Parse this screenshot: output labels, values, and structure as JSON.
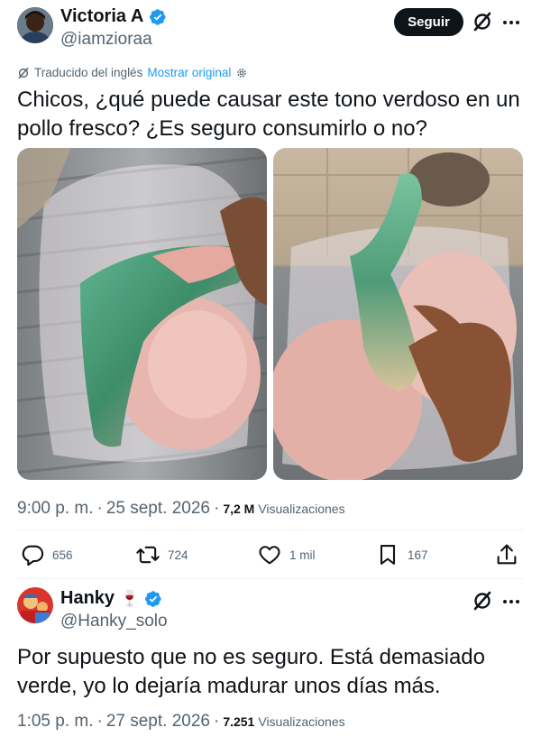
{
  "tweet": {
    "author_name": "Victoria A",
    "author_handle": "@iamzioraa",
    "follow_label": "Seguir",
    "translation_note": "Traducido del inglés",
    "show_original": "Mostrar original",
    "text": "Chicos, ¿qué puede causar este tono verdoso en un pollo fresco? ¿Es seguro consumirlo o no?",
    "time": "9:00 p. m.",
    "separator": "·",
    "date": "25 sept. 2026",
    "views_count": "7,2 M",
    "views_label": "Visualizaciones",
    "replies": "656",
    "retweets": "724",
    "likes": "1 mil",
    "bookmarks": "167"
  },
  "reply": {
    "author_name": "Hanky",
    "author_emoji": "🍷",
    "author_handle": "@Hanky_solo",
    "text": "Por supuesto que no es seguro. Está demasiado verde, yo lo dejaría madurar unos días más.",
    "time": "1:05 p. m.",
    "separator": "·",
    "date": "27 sept. 2026",
    "views_count": "7.251",
    "views_label": "Visualizaciones"
  },
  "icons": {
    "verified": "verified-badge-icon",
    "grok": "grok-icon",
    "more": "more-icon",
    "reply": "reply-icon",
    "retweet": "retweet-icon",
    "like": "like-icon",
    "bookmark": "bookmark-icon",
    "share": "share-icon"
  },
  "colors": {
    "accent": "#1d9bf0",
    "text": "#0f1419",
    "muted": "#536471",
    "follow_bg": "#0f1419"
  }
}
